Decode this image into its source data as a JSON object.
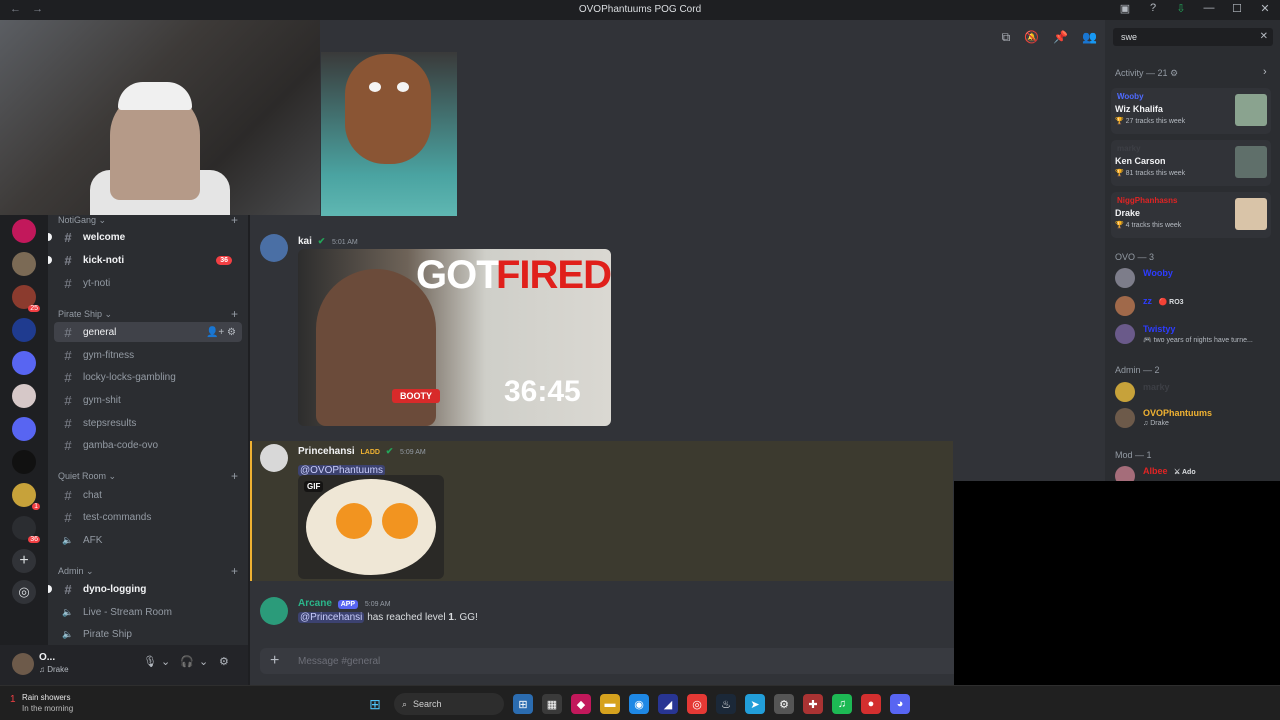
{
  "window": {
    "title": "OVOPhantuums POG Cord",
    "nav_back": "←",
    "nav_forward": "→",
    "controls": [
      "▣",
      "?",
      "⇩",
      "—",
      "☐",
      "✕"
    ]
  },
  "guilds": [
    {
      "color": "#c2185b",
      "badge": ""
    },
    {
      "color": "#7b6a55",
      "badge": ""
    },
    {
      "color": "#8b3b2e",
      "badge": "25"
    },
    {
      "color": "#1f3b8f",
      "badge": ""
    },
    {
      "color": "#5865f2",
      "badge": ""
    },
    {
      "color": "#d6c8c8",
      "badge": ""
    },
    {
      "color": "#5865f2",
      "badge": ""
    },
    {
      "color": "#111111",
      "badge": ""
    },
    {
      "color": "#c7a23a",
      "badge": "1"
    },
    {
      "color": "#2b2d31",
      "badge": "36"
    }
  ],
  "guild_actions": {
    "add": "+",
    "discover": "◎"
  },
  "sidebar": {
    "categories": [
      {
        "label": "NotiGang ⌄"
      },
      {
        "label": "Pirate Ship ⌄"
      },
      {
        "label": "Quiet Room ⌄"
      },
      {
        "label": "Admin ⌄"
      }
    ],
    "add_symbol": "+",
    "channels": [
      {
        "label": "welcome",
        "icon": "#",
        "unread": true
      },
      {
        "label": "kick-noti",
        "icon": "#",
        "unread": true,
        "mentions": "36"
      },
      {
        "label": "yt-noti",
        "icon": "#"
      },
      {
        "label": "general",
        "icon": "#",
        "active": true
      },
      {
        "label": "gym-fitness",
        "icon": "#"
      },
      {
        "label": "locky-locks-gambling",
        "icon": "#"
      },
      {
        "label": "gym-shit",
        "icon": "#"
      },
      {
        "label": "stepsresults",
        "icon": "#"
      },
      {
        "label": "gamba-code-ovo",
        "icon": "#"
      },
      {
        "label": "chat",
        "icon": "#"
      },
      {
        "label": "test-commands",
        "icon": "#"
      },
      {
        "label": "AFK",
        "icon": "🔈"
      },
      {
        "label": "dyno-logging",
        "icon": "#",
        "unread": true
      },
      {
        "label": "Live - Stream Room",
        "icon": "🔈"
      },
      {
        "label": "Pirate Ship",
        "icon": "🔈"
      }
    ],
    "channel_tools": "👤+ ⚙"
  },
  "user": {
    "name": "O...",
    "status": "♫ Drake",
    "mic": "🎙",
    "headset": "🎧",
    "settings": "⚙",
    "caret": "⌄"
  },
  "chat": {
    "header_icons": [
      "⧉",
      "🔕",
      "📌",
      "👥"
    ],
    "messages": [
      {
        "author": "kai",
        "time": "5:01 AM",
        "verified": "✔"
      },
      {
        "author": "Princehansi",
        "role": "LADD",
        "time": "5:09 AM",
        "verified": "✔",
        "mention": "@OVOPhantuums"
      },
      {
        "author": "Arcane",
        "app": "APP",
        "time": "5:09 AM",
        "mention": "@Princehansi",
        "text_before": "has reached level",
        "level": "1",
        "text_after": ". GG!"
      }
    ],
    "video": {
      "title_white": "GOT",
      "title_red": "FIRED..",
      "duration": "36:45",
      "tag": "BOOTY"
    },
    "gif_label": "GIF",
    "composer_placeholder": "Message #general",
    "composer_add": "+"
  },
  "search": {
    "value": "swe",
    "clear": "✕"
  },
  "activity": {
    "header": "Activity — 21 ⚙",
    "chevron": "›",
    "cards": [
      {
        "user": "Wooby",
        "user_color": "#4f6bff",
        "artist": "Wiz Khalifa",
        "tracks": "🏆 27 tracks this week",
        "art_color": "#8aa38f"
      },
      {
        "user": "marky",
        "user_color": "#3d3f45",
        "artist": "Ken Carson",
        "tracks": "🏆 81 tracks this week",
        "art_color": "#5f6f6a"
      },
      {
        "user": "NiggPhanhasns",
        "user_color": "#e02424",
        "artist": "Drake",
        "tracks": "🏆 4 tracks this week",
        "art_color": "#d9c4a8"
      }
    ]
  },
  "members": {
    "groups": [
      {
        "label": "OVO — 3"
      },
      {
        "label": "Admin — 2"
      },
      {
        "label": "Mod — 1"
      }
    ],
    "list": [
      {
        "name": "Wooby",
        "color": "#2d3cff",
        "status": "",
        "av": "#7d7d8a"
      },
      {
        "name": "zz",
        "color": "#2d3cff",
        "status": "",
        "badge": "🔴 RO3",
        "av": "#a0694a"
      },
      {
        "name": "Twistyy",
        "color": "#2d3cff",
        "status": "🎮 two years of nights have turne...",
        "av": "#6a5a8a"
      },
      {
        "name": "marky",
        "color": "#3d3f45",
        "status": "",
        "av": "#c7a23a"
      },
      {
        "name": "OVOPhantuums",
        "color": "#f0b232",
        "status": "♫ Drake",
        "av": "#6d5a4a"
      },
      {
        "name": "Albee",
        "color": "#e02424",
        "status": "",
        "badge": "⚔ Ado",
        "av": "#a56d7a"
      }
    ]
  },
  "taskbar": {
    "weather_title": "Rain showers",
    "weather_sub": "In the morning",
    "weather_icon": "1",
    "search_label": "Search",
    "apps": [
      {
        "glyph": "⊞",
        "color": "#2b6cb0"
      },
      {
        "glyph": "▦",
        "color": "#3a3a3a"
      },
      {
        "glyph": "◆",
        "color": "#c2185b"
      },
      {
        "glyph": "▬",
        "color": "#d6a21e"
      },
      {
        "glyph": "◉",
        "color": "#1e88e5"
      },
      {
        "glyph": "◢",
        "color": "#283593"
      },
      {
        "glyph": "◎",
        "color": "#e53935"
      },
      {
        "glyph": "♨",
        "color": "#1b2838"
      },
      {
        "glyph": "➤",
        "color": "#229ed9"
      },
      {
        "glyph": "⚙",
        "color": "#555555"
      },
      {
        "glyph": "✚",
        "color": "#a33"
      },
      {
        "glyph": "♫",
        "color": "#1db954"
      },
      {
        "glyph": "●",
        "color": "#d32f2f"
      },
      {
        "glyph": "◕",
        "color": "#5865f2"
      }
    ]
  }
}
